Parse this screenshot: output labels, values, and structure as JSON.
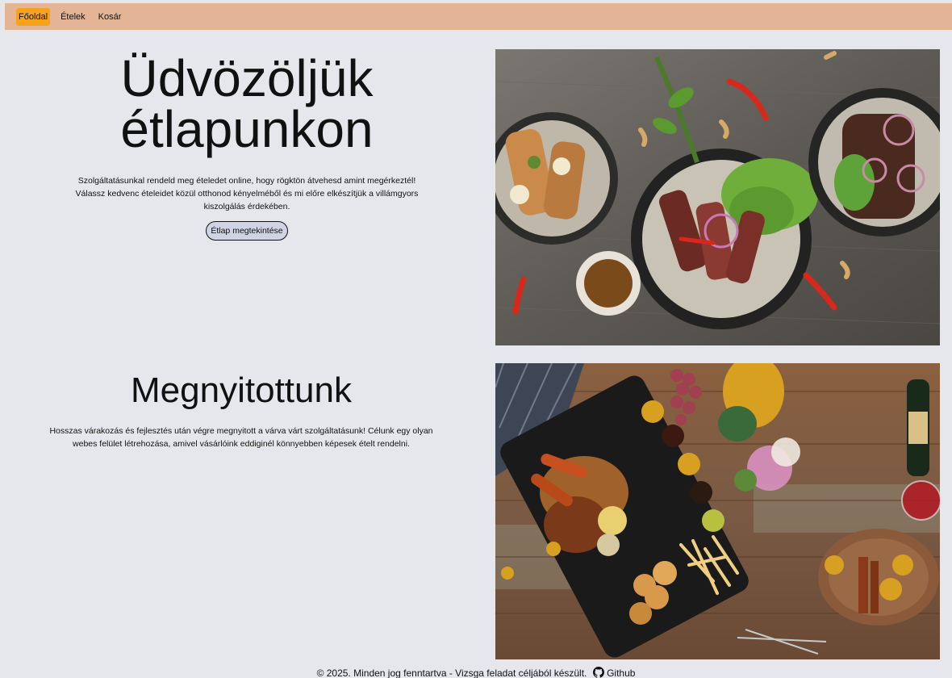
{
  "nav": {
    "items": [
      {
        "label": "Főoldal",
        "active": true
      },
      {
        "label": "Ételek",
        "active": false
      },
      {
        "label": "Kosár",
        "active": false
      }
    ]
  },
  "hero": {
    "title_line1": "Üdvözöljük",
    "title_line2": "étlapunkon",
    "description": "Szolgáltatásunkal rendeld meg ételedet online, hogy rögktön átvehesd amint megérkeztél! Válassz kedvenc ételeidet közül otthonod kényelméből és mi előre elkészítjük a villámgyors kiszolgálás érdekében.",
    "button_label": "Étlap megtekintése"
  },
  "opening": {
    "title": "Megnyitottunk",
    "description": "Hosszas várakozás és fejlesztés után végre megnyitott a várva várt szolgáltatásunk! Célunk egy olyan webes felület létrehozása, amivel vásárlóink eddiginél könnyebben képesek ételt rendelni."
  },
  "footer": {
    "text": "© 2025. Minden jog fenntartva - Vizsga feladat céljából készült.",
    "github_label": "Github",
    "github_icon": "github-icon"
  },
  "colors": {
    "navbar": "#e3b596",
    "active_nav": "#f6a21a",
    "background": "#e6e7ec"
  }
}
